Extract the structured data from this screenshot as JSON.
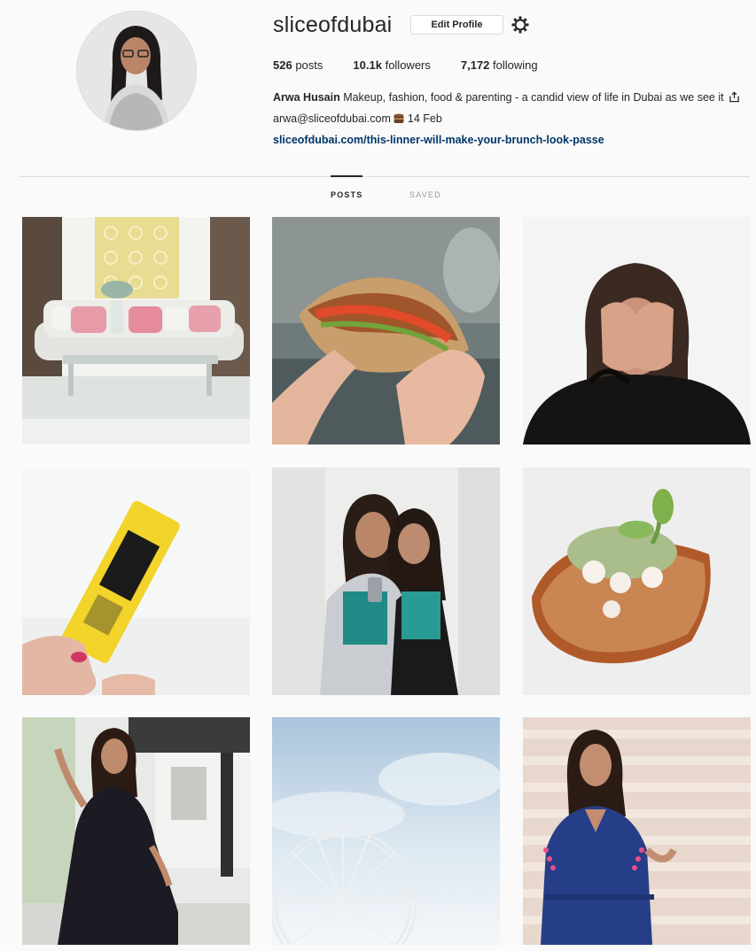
{
  "profile": {
    "username": "sliceofdubai",
    "edit_label": "Edit Profile",
    "settings_icon": "gear-icon",
    "avatar_icon": "profile-photo"
  },
  "stats": {
    "posts_count": "526",
    "posts_label": "posts",
    "followers_count": "10.1k",
    "followers_label": "followers",
    "following_count": "7,172",
    "following_label": "following"
  },
  "bio": {
    "full_name": "Arwa Husain",
    "text_1": " Makeup, fashion, food & parenting - a candid view of life in Dubai as we see it ",
    "email": "arwa@sliceofdubai.com",
    "date": "14 Feb",
    "link": "sliceofdubai.com/this-linner-will-make-your-brunch-look-passe"
  },
  "tabs": {
    "posts": "POSTS",
    "saved": "SAVED"
  },
  "posts": [
    {
      "subject": "living-room-sofa"
    },
    {
      "subject": "hand-holding-sandwich"
    },
    {
      "subject": "woman-covering-eyes"
    },
    {
      "subject": "yellow-balm-tube"
    },
    {
      "subject": "two-women-selfie"
    },
    {
      "subject": "toast-with-cheese"
    },
    {
      "subject": "woman-black-dress"
    },
    {
      "subject": "ferris-wheel-sky"
    },
    {
      "subject": "woman-blue-dress"
    }
  ],
  "colors": {
    "link": "#003569",
    "border": "#dbdbdb",
    "background": "#fafafa"
  }
}
